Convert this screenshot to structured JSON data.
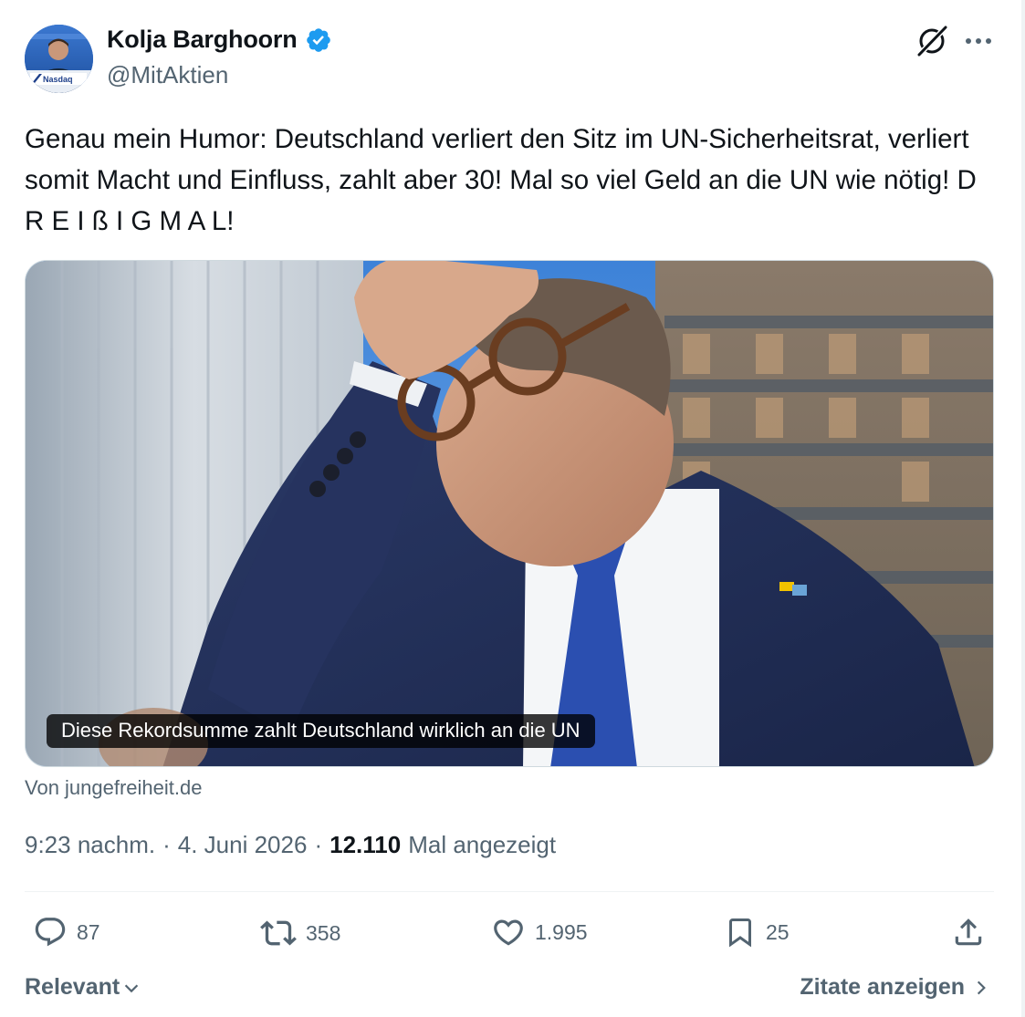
{
  "author": {
    "name": "Kolja Barghoorn",
    "handle": "@MitAktien",
    "avatar_badge_text": "Nasdaq",
    "verified": true
  },
  "tweet": {
    "text": "Genau mein Humor: Deutschland verliert den Sitz im UN-Sicherheitsrat, verliert somit Macht und Einfluss, zahlt aber 30! Mal so viel Geld an die UN wie nötig! D R E I ß I G   M A L!"
  },
  "media": {
    "caption": "Diese Rekordsumme zahlt Deutschland wirklich an die UN",
    "source": "Von jungefreiheit.de"
  },
  "meta": {
    "time": "9:23 nachm.",
    "separator": "·",
    "date": "4. Juni 2026",
    "views_count": "12.110",
    "views_label": "Mal angezeigt"
  },
  "actions": {
    "replies": "87",
    "reposts": "358",
    "likes": "1.995",
    "bookmarks": "25"
  },
  "footer": {
    "sort_label": "Relevant",
    "quotes_label": "Zitate anzeigen"
  },
  "colors": {
    "text_primary": "#0f1419",
    "text_secondary": "#536471",
    "verified_blue": "#1d9bf0",
    "divider": "#eff3f4"
  },
  "icons": [
    "verified-badge-icon",
    "grok-icon",
    "more-icon",
    "reply-icon",
    "retweet-icon",
    "like-icon",
    "bookmark-icon",
    "share-icon",
    "chevron-down-icon",
    "chevron-right-icon"
  ]
}
